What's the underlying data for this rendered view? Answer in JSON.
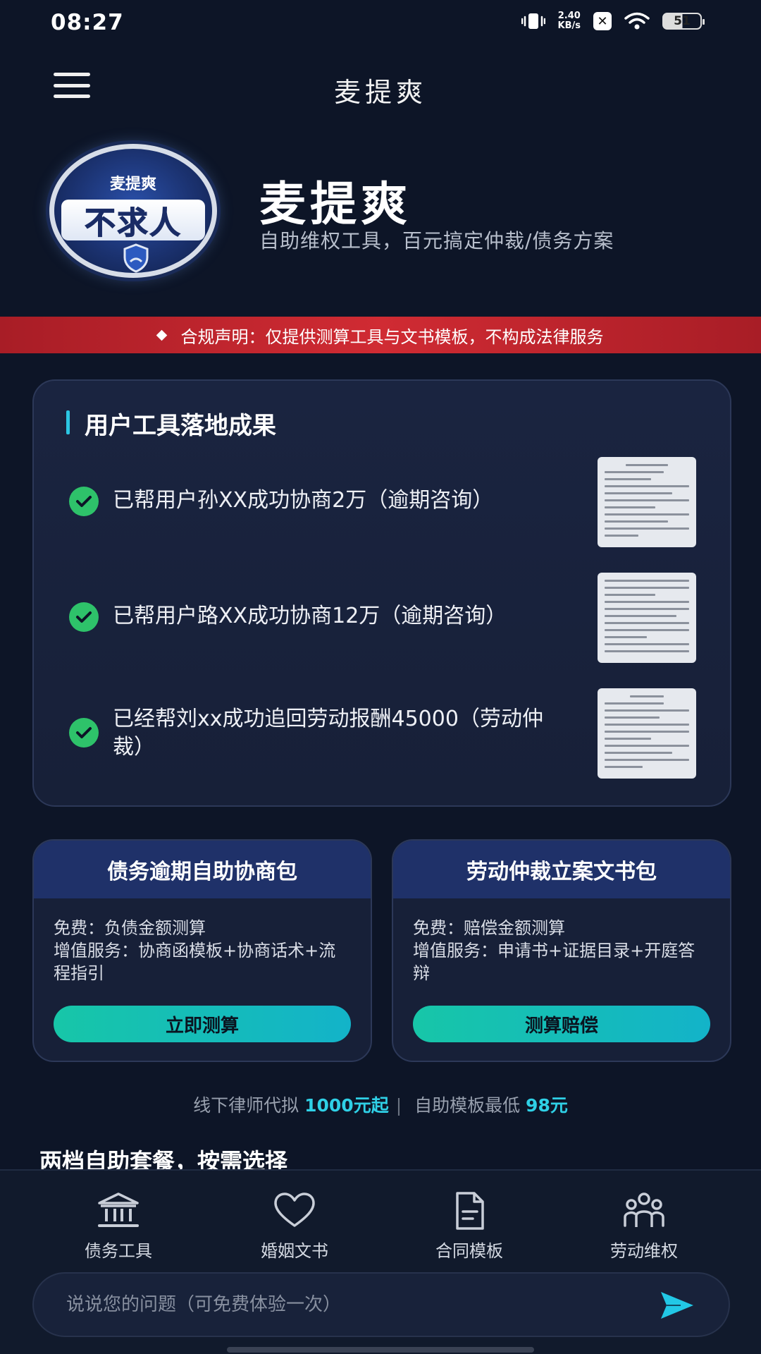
{
  "status_bar": {
    "time": "08:27",
    "net_speed_value": "2.40",
    "net_speed_unit": "KB/s",
    "battery": "51"
  },
  "header": {
    "title": "麦提爽"
  },
  "hero": {
    "logo_top_text": "麦提爽",
    "logo_main_text": "不求人",
    "brand_name": "麦提爽",
    "tagline": "自助维权工具，百元搞定仲裁/债务方案"
  },
  "compliance": {
    "text": "合规声明：仅提供测算工具与文书模板，不构成法律服务"
  },
  "results": {
    "title": "用户工具落地成果",
    "items": [
      {
        "text": "已帮用户孙XX成功协商2万（逾期咨询）"
      },
      {
        "text": "已帮用户路XX成功协商12万（逾期咨询）"
      },
      {
        "text": "已经帮刘xx成功追回劳动报酬45000（劳动仲裁）"
      }
    ]
  },
  "packages": [
    {
      "title": "债务逾期自助协商包",
      "free_line": "免费：负债金额测算",
      "value_line": "增值服务：协商函模板+协商话术+流程指引",
      "button": "立即测算"
    },
    {
      "title": "劳动仲裁立案文书包",
      "free_line": "免费：赔偿金额测算",
      "value_line": "增值服务：申请书+证据目录+开庭答辩",
      "button": "测算赔偿"
    }
  ],
  "price_note": {
    "prefix": "线下律师代拟 ",
    "lawyer_price": "1000元起",
    "separator": "|",
    "middle": " 自助模板最低 ",
    "self_price": "98元"
  },
  "section_heading": "两档自助套餐，按需选择",
  "bottom_nav": {
    "items": [
      {
        "label": "债务工具",
        "icon": "bank-icon"
      },
      {
        "label": "婚姻文书",
        "icon": "heart-icon"
      },
      {
        "label": "合同模板",
        "icon": "document-icon"
      },
      {
        "label": "劳动维权",
        "icon": "people-icon"
      }
    ]
  },
  "chat": {
    "placeholder": "说说您的问题（可免费体验一次）"
  },
  "colors": {
    "background": "#0d1527",
    "accent": "#2fd0e6",
    "button_gradient_start": "#17c6a8",
    "compliance_red": "#c8242d",
    "check_green": "#2ec26a"
  }
}
